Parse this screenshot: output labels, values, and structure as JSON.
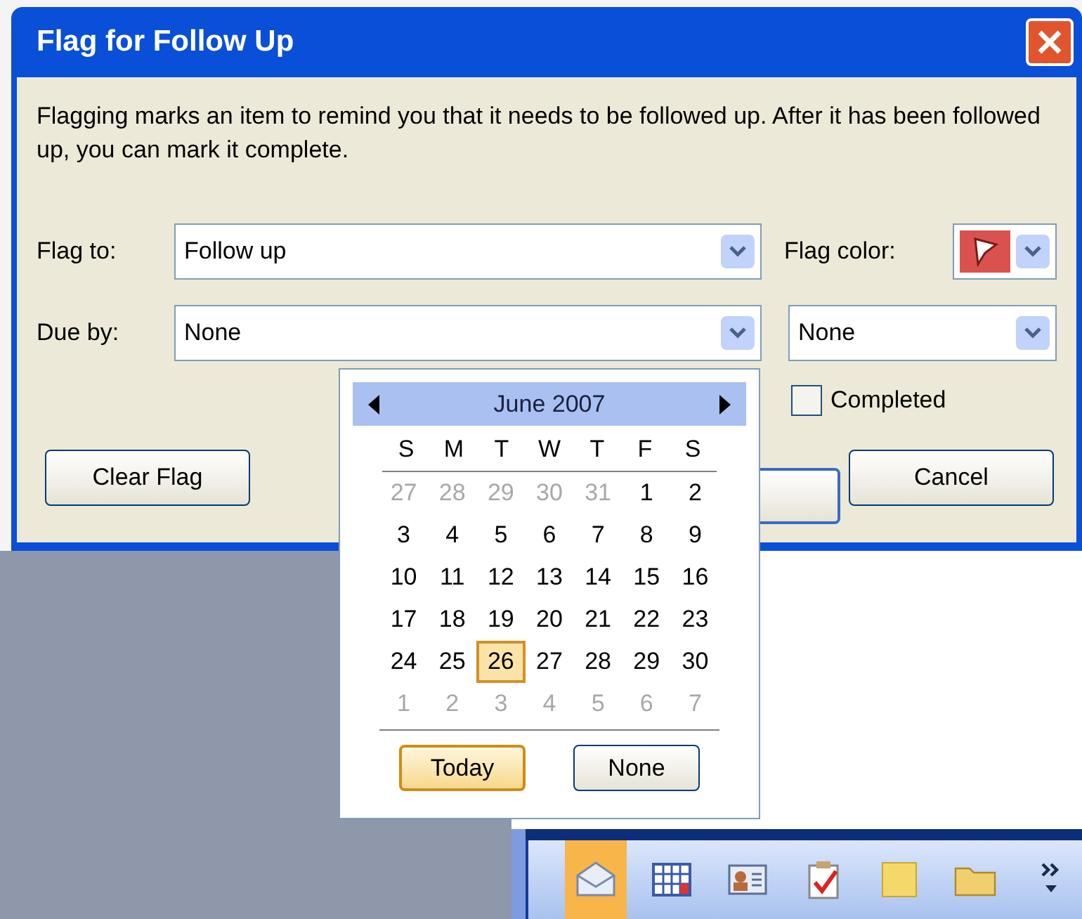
{
  "window": {
    "title": "Flag for Follow Up"
  },
  "description": "Flagging marks an item to remind you that it needs to be followed up.  After it has been followed up, you can mark it complete.",
  "flag_to": {
    "label": "Flag to:",
    "value": "Follow up"
  },
  "flag_color": {
    "label": "Flag color:",
    "color": "#d9524f"
  },
  "due_by": {
    "label": "Due by:",
    "date_value": "None",
    "time_value": "None"
  },
  "completed": {
    "label": "Completed",
    "checked": false
  },
  "buttons": [
    {
      "label": "Clear Flag",
      "kind": "left"
    },
    {
      "label": "Cancel",
      "kind": "right"
    }
  ],
  "calendar": {
    "month": "June 2007",
    "weekdays": [
      "S",
      "M",
      "T",
      "W",
      "T",
      "F",
      "S"
    ],
    "days": [
      {
        "label": "27",
        "muted": true,
        "selected": false
      },
      {
        "label": "28",
        "muted": true,
        "selected": false
      },
      {
        "label": "29",
        "muted": true,
        "selected": false
      },
      {
        "label": "30",
        "muted": true,
        "selected": false
      },
      {
        "label": "31",
        "muted": true,
        "selected": false
      },
      {
        "label": "1",
        "muted": false,
        "selected": false
      },
      {
        "label": "2",
        "muted": false,
        "selected": false
      },
      {
        "label": "3",
        "muted": false,
        "selected": false
      },
      {
        "label": "4",
        "muted": false,
        "selected": false
      },
      {
        "label": "5",
        "muted": false,
        "selected": false
      },
      {
        "label": "6",
        "muted": false,
        "selected": false
      },
      {
        "label": "7",
        "muted": false,
        "selected": false
      },
      {
        "label": "8",
        "muted": false,
        "selected": false
      },
      {
        "label": "9",
        "muted": false,
        "selected": false
      },
      {
        "label": "10",
        "muted": false,
        "selected": false
      },
      {
        "label": "11",
        "muted": false,
        "selected": false
      },
      {
        "label": "12",
        "muted": false,
        "selected": false
      },
      {
        "label": "13",
        "muted": false,
        "selected": false
      },
      {
        "label": "14",
        "muted": false,
        "selected": false
      },
      {
        "label": "15",
        "muted": false,
        "selected": false
      },
      {
        "label": "16",
        "muted": false,
        "selected": false
      },
      {
        "label": "17",
        "muted": false,
        "selected": false
      },
      {
        "label": "18",
        "muted": false,
        "selected": false
      },
      {
        "label": "19",
        "muted": false,
        "selected": false
      },
      {
        "label": "20",
        "muted": false,
        "selected": false
      },
      {
        "label": "21",
        "muted": false,
        "selected": false
      },
      {
        "label": "22",
        "muted": false,
        "selected": false
      },
      {
        "label": "23",
        "muted": false,
        "selected": false
      },
      {
        "label": "24",
        "muted": false,
        "selected": false
      },
      {
        "label": "25",
        "muted": false,
        "selected": false
      },
      {
        "label": "26",
        "muted": false,
        "selected": true
      },
      {
        "label": "27",
        "muted": false,
        "selected": false
      },
      {
        "label": "28",
        "muted": false,
        "selected": false
      },
      {
        "label": "29",
        "muted": false,
        "selected": false
      },
      {
        "label": "30",
        "muted": false,
        "selected": false
      },
      {
        "label": "1",
        "muted": true,
        "selected": false
      },
      {
        "label": "2",
        "muted": true,
        "selected": false
      },
      {
        "label": "3",
        "muted": true,
        "selected": false
      },
      {
        "label": "4",
        "muted": true,
        "selected": false
      },
      {
        "label": "5",
        "muted": true,
        "selected": false
      },
      {
        "label": "6",
        "muted": true,
        "selected": false
      },
      {
        "label": "7",
        "muted": true,
        "selected": false
      }
    ],
    "buttons": [
      {
        "label": "Today",
        "selected": true
      },
      {
        "label": "None",
        "selected": false
      }
    ]
  },
  "nav_pane": {
    "buttons": [
      {
        "kind": "mail",
        "selected": true
      },
      {
        "kind": "calendar",
        "selected": false
      },
      {
        "kind": "contacts",
        "selected": false
      },
      {
        "kind": "tasks",
        "selected": false
      },
      {
        "kind": "notes",
        "selected": false
      },
      {
        "kind": "folder",
        "selected": false
      },
      {
        "kind": "more",
        "selected": false
      }
    ]
  }
}
